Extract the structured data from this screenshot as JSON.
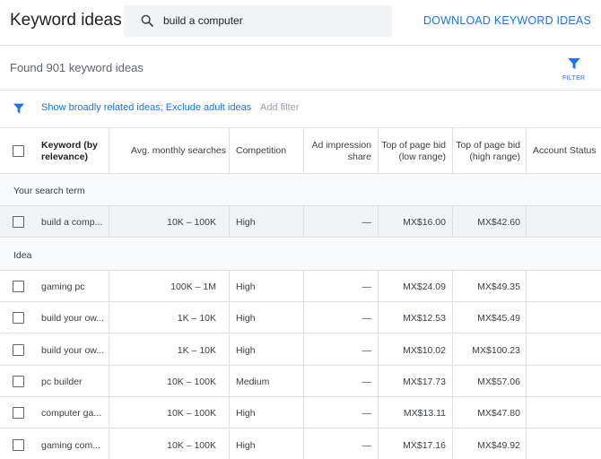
{
  "header": {
    "title": "Keyword ideas",
    "search_value": "build a computer",
    "download_label": "DOWNLOAD KEYWORD IDEAS"
  },
  "summary": {
    "found_text": "Found 901 keyword ideas",
    "filter_label": "FILTER"
  },
  "filters": {
    "applied": "Show broadly related ideas; Exclude adult ideas",
    "add_filter": "Add filter"
  },
  "table": {
    "columns": {
      "keyword": "Keyword (by relevance)",
      "searches": "Avg. monthly searches",
      "competition": "Competition",
      "impression": "Ad impression share",
      "bid_low": "Top of page bid (low range)",
      "bid_high": "Top of page bid (high range)",
      "status": "Account Status"
    },
    "search_term_section": "Your search term",
    "search_term_row": {
      "keyword": "build a comp...",
      "searches": "10K – 100K",
      "competition": "High",
      "impression": "—",
      "bid_low": "MX$16.00",
      "bid_high": "MX$42.60",
      "status": ""
    },
    "idea_section": "Idea",
    "rows": [
      {
        "keyword": "gaming pc",
        "searches": "100K – 1M",
        "competition": "High",
        "impression": "—",
        "bid_low": "MX$24.09",
        "bid_high": "MX$49.35",
        "status": ""
      },
      {
        "keyword": "build your ow...",
        "searches": "1K – 10K",
        "competition": "High",
        "impression": "—",
        "bid_low": "MX$12.53",
        "bid_high": "MX$45.49",
        "status": ""
      },
      {
        "keyword": "build your ow...",
        "searches": "1K – 10K",
        "competition": "High",
        "impression": "—",
        "bid_low": "MX$10.02",
        "bid_high": "MX$100.23",
        "status": ""
      },
      {
        "keyword": "pc builder",
        "searches": "10K – 100K",
        "competition": "Medium",
        "impression": "—",
        "bid_low": "MX$17.73",
        "bid_high": "MX$57.06",
        "status": ""
      },
      {
        "keyword": "computer ga...",
        "searches": "10K – 100K",
        "competition": "High",
        "impression": "—",
        "bid_low": "MX$13.11",
        "bid_high": "MX$47.80",
        "status": ""
      },
      {
        "keyword": "gaming com...",
        "searches": "10K – 100K",
        "competition": "High",
        "impression": "—",
        "bid_low": "MX$17.16",
        "bid_high": "MX$49.92",
        "status": ""
      }
    ]
  },
  "icons": {
    "search": "search-icon",
    "filter": "filter-icon"
  },
  "colors": {
    "accent": "#1a73e8",
    "text": "#3c4043",
    "muted": "#9aa0a6",
    "divider": "#e0e0e0"
  }
}
